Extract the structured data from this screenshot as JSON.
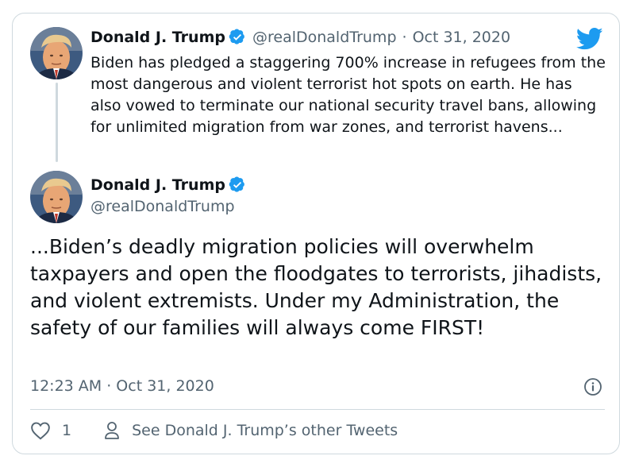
{
  "tweet1": {
    "name": "Donald J. Trump",
    "handle": "@realDonaldTrump",
    "date": "Oct 31, 2020",
    "text": "Biden has pledged a staggering 700% increase in refugees from the most dangerous and violent terrorist hot spots on earth. He has also vowed to terminate our national security travel bans, allowing for unlimited migration from war zones, and terrorist havens..."
  },
  "tweet2": {
    "name": "Donald J. Trump",
    "handle": "@realDonaldTrump",
    "text": "...Biden’s deadly migration policies will overwhelm taxpayers and open the floodgates to terrorists, jihadists, and violent extremists. Under my Administration, the safety of our families will always come FIRST!",
    "timestamp": "12:23 AM · Oct 31, 2020"
  },
  "actions": {
    "like_count": "1",
    "see_other": "See Donald J. Trump’s other Tweets"
  },
  "colors": {
    "twitter_blue": "#1d9bf0",
    "text_primary": "#0f1419",
    "text_secondary": "#536471",
    "border": "#cfd9de"
  },
  "icons": [
    "twitter-bird-icon",
    "verified-badge-icon",
    "info-icon",
    "heart-icon",
    "person-icon"
  ]
}
